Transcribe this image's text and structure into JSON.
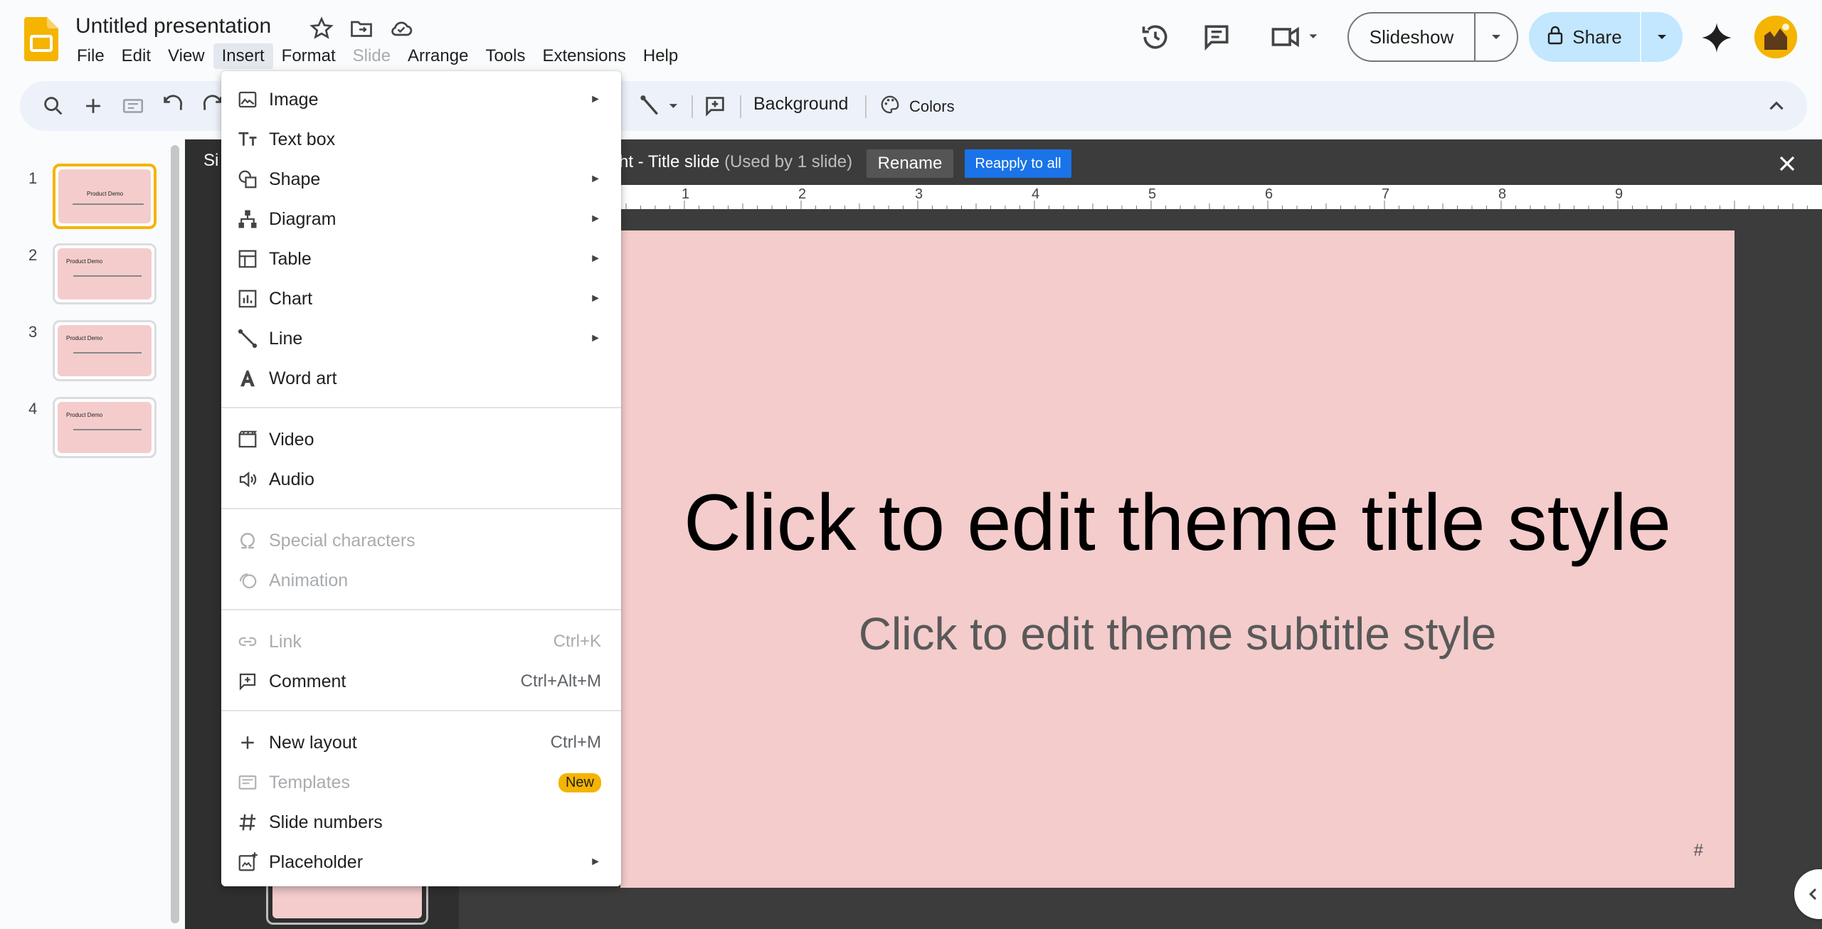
{
  "app": {
    "document_title": "Untitled presentation"
  },
  "menubar": {
    "items": [
      {
        "label": "File"
      },
      {
        "label": "Edit"
      },
      {
        "label": "View"
      },
      {
        "label": "Insert"
      },
      {
        "label": "Format"
      },
      {
        "label": "Slide"
      },
      {
        "label": "Arrange"
      },
      {
        "label": "Tools"
      },
      {
        "label": "Extensions"
      },
      {
        "label": "Help"
      }
    ]
  },
  "header": {
    "slideshow_label": "Slideshow",
    "share_label": "Share"
  },
  "toolbar": {
    "background_label": "Background",
    "colors_label": "Colors"
  },
  "filmstrip": {
    "slides": [
      {
        "number": "1",
        "title": "Product Demo"
      },
      {
        "number": "2",
        "title": "Product Demo"
      },
      {
        "number": "3",
        "title": "Product Demo"
      },
      {
        "number": "4",
        "title": "Product Demo"
      }
    ]
  },
  "layout_bar": {
    "left_fragment": "Si",
    "name": "ht - Title slide",
    "used": "(Used by 1 slide)",
    "rename_label": "Rename",
    "reapply_label": "Reapply to all"
  },
  "ruler": {
    "numbers": [
      "1",
      "2",
      "3",
      "4",
      "5",
      "6",
      "7",
      "8",
      "9"
    ]
  },
  "canvas": {
    "title": "Click to edit theme title style",
    "subtitle": "Click to edit theme subtitle style",
    "slide_number_placeholder": "#",
    "background_color": "#f4cccc"
  },
  "insert_menu": {
    "items": [
      {
        "label": "Image",
        "icon": "image-icon",
        "submenu": true
      },
      {
        "label": "Text box",
        "icon": "text-box-icon"
      },
      {
        "label": "Shape",
        "icon": "shape-icon",
        "submenu": true
      },
      {
        "label": "Diagram",
        "icon": "diagram-icon",
        "submenu": true
      },
      {
        "label": "Table",
        "icon": "table-icon",
        "submenu": true
      },
      {
        "label": "Chart",
        "icon": "chart-icon",
        "submenu": true
      },
      {
        "label": "Line",
        "icon": "line-icon",
        "submenu": true
      },
      {
        "label": "Word art",
        "icon": "word-art-icon"
      },
      {
        "label": "Video",
        "icon": "video-icon"
      },
      {
        "label": "Audio",
        "icon": "audio-icon"
      },
      {
        "label": "Special characters",
        "icon": "omega-icon",
        "disabled": true
      },
      {
        "label": "Animation",
        "icon": "animation-icon",
        "disabled": true
      },
      {
        "label": "Link",
        "icon": "link-icon",
        "shortcut": "Ctrl+K",
        "disabled": true
      },
      {
        "label": "Comment",
        "icon": "comment-add-icon",
        "shortcut": "Ctrl+Alt+M"
      },
      {
        "label": "New layout",
        "icon": "plus-icon",
        "shortcut": "Ctrl+M"
      },
      {
        "label": "Templates",
        "icon": "templates-icon",
        "badge": "New",
        "disabled": true
      },
      {
        "label": "Slide numbers",
        "icon": "hash-icon"
      },
      {
        "label": "Placeholder",
        "icon": "placeholder-icon",
        "submenu": true
      }
    ]
  },
  "colors": {
    "accent_blue": "#1a73e8",
    "share_bg": "#c2e7ff",
    "selected_thumb_border": "#f4b400",
    "new_badge": "#f4b400",
    "editor_dark": "#3c3c3c"
  }
}
